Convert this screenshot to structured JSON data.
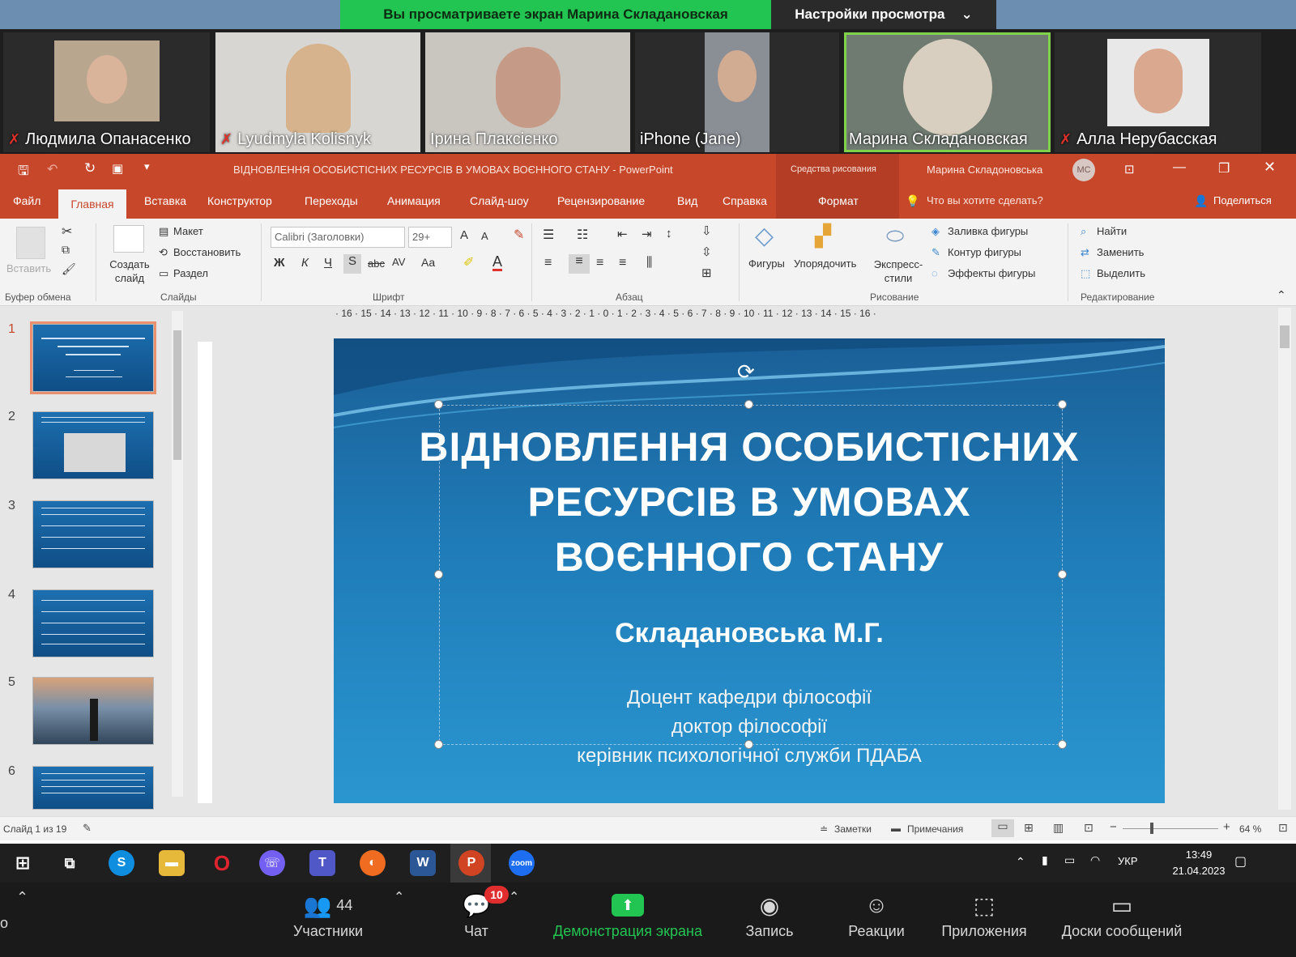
{
  "zoom": {
    "share_banner": "Вы просматриваете экран Марина Складановская",
    "view_settings": "Настройки просмотра",
    "participants": [
      {
        "name": "Людмила Опанасенко",
        "muted": true
      },
      {
        "name": "Lyudmyla Kolisnyk",
        "muted": true
      },
      {
        "name": "Ірина Плаксієнко",
        "muted": false
      },
      {
        "name": "iPhone (Jane)",
        "muted": false
      },
      {
        "name": "Марина Складановская",
        "muted": false
      },
      {
        "name": "Алла Нерубасская",
        "muted": true
      }
    ],
    "toolbar": {
      "participants_label": "Участники",
      "participants_count": "44",
      "chat_label": "Чат",
      "chat_badge": "10",
      "share_label": "Демонстрация экрана",
      "record_label": "Запись",
      "reactions_label": "Реакции",
      "apps_label": "Приложения",
      "whiteboard_label": "Доски сообщений",
      "left_fragment": "о"
    }
  },
  "ppt": {
    "window_title": "ВІДНОВЛЕННЯ ОСОБИСТІСНИХ РЕСУРСІВ В УМОВАХ ВОЄННОГО СТАНУ  -  PowerPoint",
    "drawing_tools": "Средства рисования",
    "user_name": "Марина  Складоновська",
    "user_initials": "МС",
    "tabs": [
      "Файл",
      "Главная",
      "Вставка",
      "Конструктор",
      "Переходы",
      "Анимация",
      "Слайд-шоу",
      "Рецензирование",
      "Вид",
      "Справка",
      "Формат"
    ],
    "tell_me": "Что вы хотите сделать?",
    "share": "Поделиться",
    "ribbon": {
      "paste": "Вставить",
      "clipboard": "Буфер обмена",
      "new_slide": "Создать слайд",
      "layout": "Макет",
      "reset": "Восстановить",
      "section": "Раздел",
      "slides": "Слайды",
      "font_name": "Calibri (Заголовки)",
      "font_size": "29+",
      "font": "Шрифт",
      "paragraph": "Абзац",
      "shapes": "Фигуры",
      "arrange": "Упорядочить",
      "quick_styles": "Экспресс-стили",
      "shape_fill": "Заливка фигуры",
      "shape_outline": "Контур фигуры",
      "shape_effects": "Эффекты фигуры",
      "drawing": "Рисование",
      "find": "Найти",
      "replace": "Заменить",
      "select": "Выделить",
      "editing": "Редактирование"
    },
    "slide": {
      "title_lines": [
        "ВІДНОВЛЕННЯ ОСОБИСТІСНИХ",
        "РЕСУРСІВ В УМОВАХ",
        "ВОЄННОГО СТАНУ"
      ],
      "author": "Складановська М.Г.",
      "sub1": "Доцент кафедри філософії",
      "sub2": "доктор філософії",
      "sub3": "керівник психологічної служби ПДАБА"
    },
    "thumbnails": [
      "1",
      "2",
      "3",
      "4",
      "5",
      "6"
    ],
    "status": {
      "slide_info": "Слайд 1 из 19",
      "notes": "Заметки",
      "comments": "Примечания",
      "zoom": "64 %"
    },
    "ruler_ticks": "· 16 · 15 · 14 · 13 · 12 · 11 · 10 · 9 · 8 · 7 · 6 · 5 · 4 · 3 · 2 · 1 · 0 · 1 · 2 · 3 · 4 · 5 · 6 · 7 · 8 · 9 · 10 · 11 · 12 · 13 · 14 · 15 · 16 ·"
  },
  "taskbar": {
    "lang": "УКР",
    "time": "13:49",
    "date": "21.04.2023"
  },
  "colors": {
    "ppt_accent": "#c7472b",
    "zoom_green": "#23c552",
    "slide_blue": "#1f7cb8"
  }
}
